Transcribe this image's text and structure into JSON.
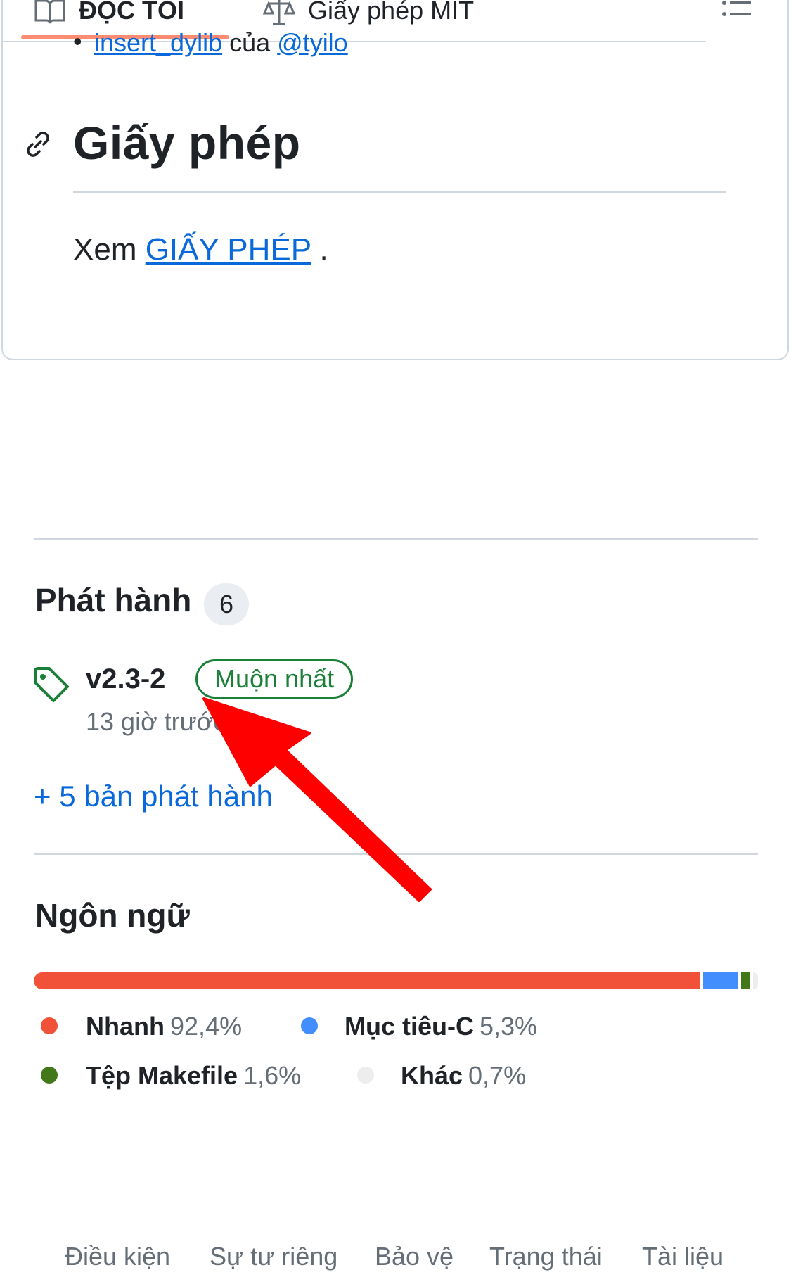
{
  "tabs": [
    {
      "label": "ĐỌC TÔI",
      "icon": "book-icon"
    },
    {
      "label": "Giấy phép MIT",
      "icon": "scale-icon"
    }
  ],
  "readme": {
    "list_item": {
      "link1": "insert_dylib",
      "middle": " của ",
      "link2": "@tyilo"
    },
    "heading": "Giấy phép",
    "license_prefix": "Xem ",
    "license_link": "GIẤY PHÉP",
    "license_suffix": " ."
  },
  "releases": {
    "title": "Phát hành",
    "count": "6",
    "latest_name": "v2.3-2",
    "latest_badge": "Muộn nhất",
    "latest_time": "13 giờ trước",
    "more_link": "+ 5 bản phát hành"
  },
  "languages": {
    "title": "Ngôn ngữ",
    "items": [
      {
        "name": "Nhanh",
        "percent": "92,4%",
        "value": 92.4,
        "color": "#f05138"
      },
      {
        "name": "Mục tiêu-C",
        "percent": "5,3%",
        "value": 5.3,
        "color": "#438eff"
      },
      {
        "name": "Tệp Makefile",
        "percent": "1,6%",
        "value": 1.6,
        "color": "#427819"
      },
      {
        "name": "Khác",
        "percent": "0,7%",
        "value": 0.7,
        "color": "#ededed"
      }
    ]
  },
  "footer": [
    "Điều kiện",
    "Sự tư riêng",
    "Bảo vệ",
    "Trạng thái",
    "Tài liệu"
  ],
  "colors": {
    "link": "#0969da",
    "tab_active": "#fd8c73",
    "latest_badge": "#1a7f37",
    "annotation_arrow": "#ff0000"
  }
}
